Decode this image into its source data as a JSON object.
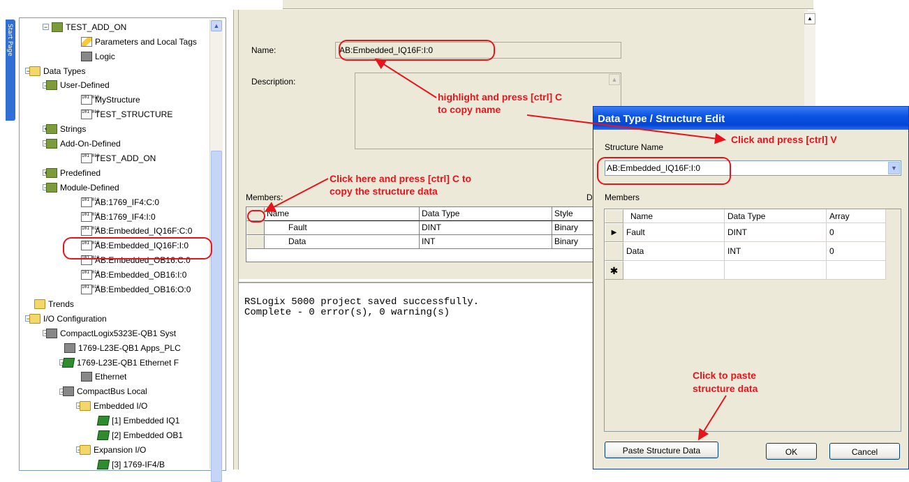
{
  "start_pane": {
    "label": "Start Page"
  },
  "tree": {
    "nodes": [
      {
        "label": "TEST_ADD_ON",
        "icon": "add-on-icon",
        "expander": "−"
      },
      {
        "label": "Parameters and Local Tags",
        "icon": "pencil-icon"
      },
      {
        "label": "Logic",
        "icon": "logic-icon"
      },
      {
        "label": "Data Types",
        "icon": "folder-icon",
        "expander": "−"
      },
      {
        "label": "User-Defined",
        "icon": "data-folder-icon",
        "expander": "−"
      },
      {
        "label": "MyStructure",
        "icon": "binary-icon"
      },
      {
        "label": "TEST_STRUCTURE",
        "icon": "binary-icon"
      },
      {
        "label": "Strings",
        "icon": "data-folder-icon",
        "expander": "+"
      },
      {
        "label": "Add-On-Defined",
        "icon": "data-folder-icon",
        "expander": "−"
      },
      {
        "label": "TEST_ADD_ON",
        "icon": "binary-icon"
      },
      {
        "label": "Predefined",
        "icon": "data-folder-icon",
        "expander": "+"
      },
      {
        "label": "Module-Defined",
        "icon": "data-folder-icon",
        "expander": "−"
      },
      {
        "label": "AB:1769_IF4:C:0",
        "icon": "binary-icon"
      },
      {
        "label": "AB:1769_IF4:I:0",
        "icon": "binary-icon"
      },
      {
        "label": "AB:Embedded_IQ16F:C:0",
        "icon": "binary-icon"
      },
      {
        "label": "AB:Embedded_IQ16F:I:0",
        "icon": "binary-icon"
      },
      {
        "label": "AB:Embedded_OB16:C:0",
        "icon": "binary-icon"
      },
      {
        "label": "AB:Embedded_OB16:I:0",
        "icon": "binary-icon"
      },
      {
        "label": "AB:Embedded_OB16:O:0",
        "icon": "binary-icon"
      },
      {
        "label": "Trends",
        "icon": "folder-icon"
      },
      {
        "label": "I/O Configuration",
        "icon": "folder-icon",
        "expander": "−"
      },
      {
        "label": "CompactLogix5323E-QB1 Syst",
        "icon": "chassis-icon",
        "expander": "−"
      },
      {
        "label": "1769-L23E-QB1 Apps_PLC",
        "icon": "controller-icon"
      },
      {
        "label": "1769-L23E-QB1 Ethernet F",
        "icon": "module-icon",
        "expander": "−"
      },
      {
        "label": "Ethernet",
        "icon": "network-icon"
      },
      {
        "label": "CompactBus Local",
        "icon": "bus-icon",
        "expander": "−"
      },
      {
        "label": "Embedded I/O",
        "icon": "folder-icon",
        "expander": "−"
      },
      {
        "label": "[1] Embedded IQ1",
        "icon": "module-icon"
      },
      {
        "label": "[2] Embedded OB1",
        "icon": "module-icon"
      },
      {
        "label": "Expansion I/O",
        "icon": "folder-icon",
        "expander": "−"
      },
      {
        "label": "[3] 1769-IF4/B",
        "icon": "module-icon"
      }
    ]
  },
  "props": {
    "name_label": "Name:",
    "name_value": "AB:Embedded_IQ16F:I:0",
    "description_label": "Description:",
    "members_label": "Members:",
    "members_trailing": "D",
    "columns": [
      "Name",
      "Data Type",
      "Style"
    ],
    "rows": [
      {
        "name": "Fault",
        "type": "DINT",
        "style": "Binary"
      },
      {
        "name": "Data",
        "type": "INT",
        "style": "Binary"
      }
    ]
  },
  "output": {
    "lines": [
      "RSLogix 5000 project saved successfully.",
      "Complete - 0 error(s), 0 warning(s)"
    ]
  },
  "dialog": {
    "title": "Data Type / Structure Edit",
    "structure_name_label": "Structure Name",
    "structure_name_value": "AB:Embedded_IQ16F:I:0",
    "members_label": "Members",
    "columns": [
      "Name",
      "Data Type",
      "Array"
    ],
    "rows": [
      {
        "marker": "▶",
        "name": "Fault",
        "type": "DINT",
        "array": "0"
      },
      {
        "marker": "",
        "name": "Data",
        "type": "INT",
        "array": "0"
      }
    ],
    "new_row_marker": "✱",
    "paste_button": "Paste Structure Data",
    "ok_button": "OK",
    "cancel_button": "Cancel"
  },
  "annotations": {
    "copy_name_1": "highlight and press [ctrl] C",
    "copy_name_2": "to copy name",
    "paste_name": "Click and press [ctrl] V",
    "copy_struct_1": "Click here and press [ctrl] C to",
    "copy_struct_2": "copy the structure data",
    "paste_struct_1": "Click to paste",
    "paste_struct_2": "structure data"
  },
  "colors": {
    "annotation": "#e8141c",
    "dialog_title": "#0b53e4",
    "start_pane": "#2f6fd6"
  }
}
